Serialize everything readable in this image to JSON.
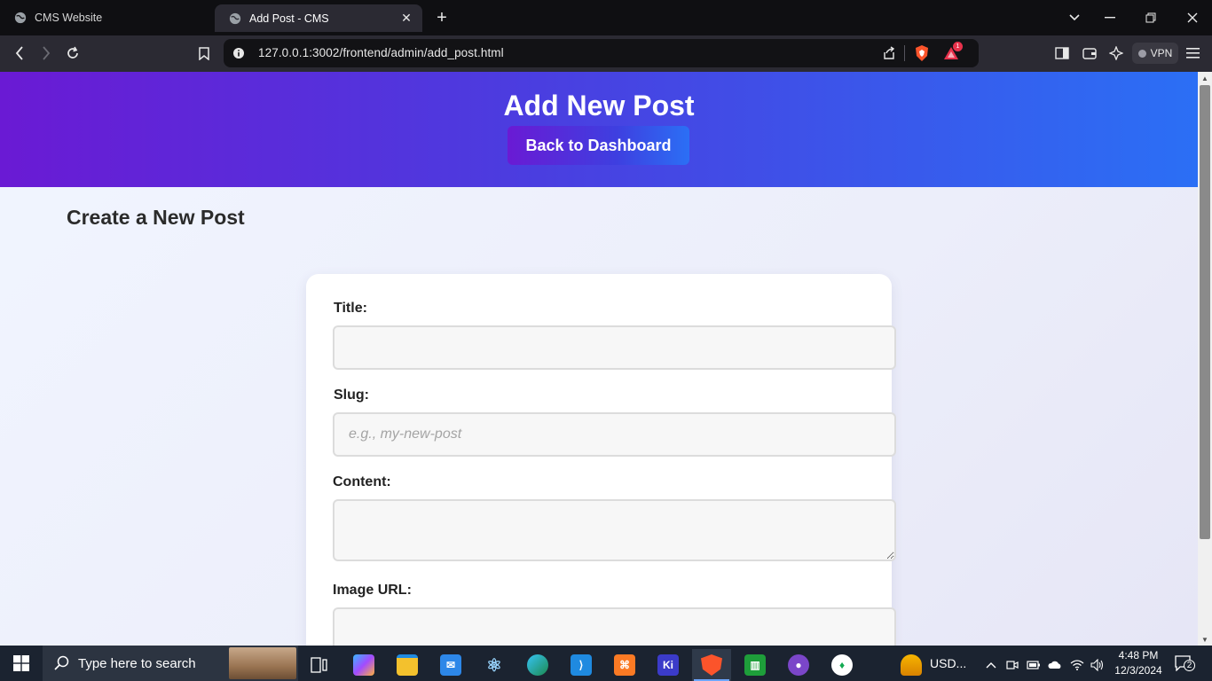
{
  "browser": {
    "tabs": [
      {
        "title": "CMS Website",
        "active": false
      },
      {
        "title": "Add Post - CMS",
        "active": true
      }
    ],
    "url": "127.0.0.1:3002/frontend/admin/add_post.html",
    "vpn_label": "VPN",
    "shields_badge": "1"
  },
  "page": {
    "header_title": "Add New Post",
    "back_button": "Back to Dashboard",
    "section_title": "Create a New Post",
    "form": {
      "title_label": "Title:",
      "title_value": "",
      "slug_label": "Slug:",
      "slug_placeholder": "e.g., my-new-post",
      "content_label": "Content:",
      "content_value": "",
      "image_label": "Image URL:",
      "image_value": ""
    }
  },
  "taskbar": {
    "search_placeholder": "Type here to search",
    "tray_currency": "USD...",
    "time": "4:48 PM",
    "date": "12/3/2024",
    "notifications": "2"
  },
  "colors": {
    "header_gradient_start": "#6a1ad4",
    "header_gradient_end": "#2b6ff5",
    "taskbar": "#1b2330"
  }
}
